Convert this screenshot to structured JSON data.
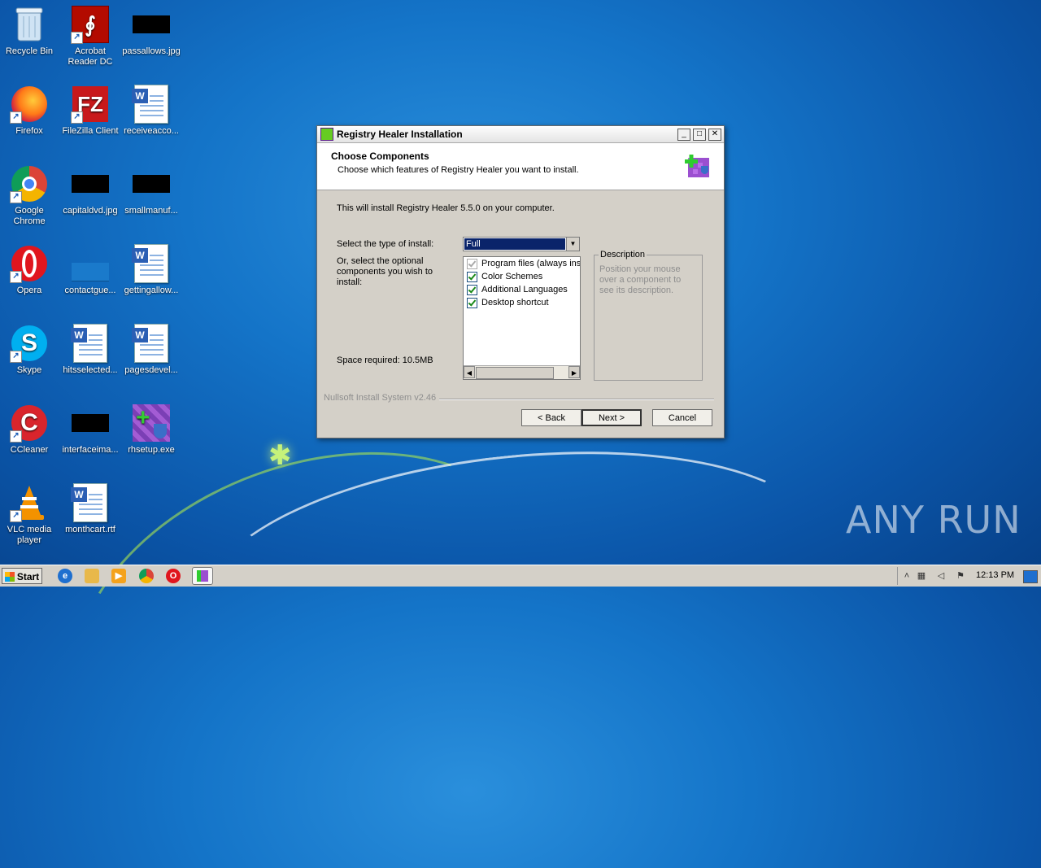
{
  "desktop": {
    "icons": [
      {
        "label": "Recycle Bin"
      },
      {
        "label": "Acrobat Reader DC"
      },
      {
        "label": "passallows.jpg"
      },
      {
        "label": "Firefox"
      },
      {
        "label": "FileZilla Client"
      },
      {
        "label": "receiveacco..."
      },
      {
        "label": "Google Chrome"
      },
      {
        "label": "capitaldvd.jpg"
      },
      {
        "label": "smallmanuf..."
      },
      {
        "label": "Opera"
      },
      {
        "label": "contactgue..."
      },
      {
        "label": "gettingallow..."
      },
      {
        "label": "Skype"
      },
      {
        "label": "hitsselected..."
      },
      {
        "label": "pagesdevel..."
      },
      {
        "label": "CCleaner"
      },
      {
        "label": "interfaceima..."
      },
      {
        "label": "rhsetup.exe"
      },
      {
        "label": "VLC media player"
      },
      {
        "label": "monthcart.rtf"
      }
    ]
  },
  "dialog": {
    "title": "Registry Healer Installation",
    "header_title": "Choose Components",
    "header_subtitle": "Choose which features of Registry Healer you want to install.",
    "intro": "This will install Registry Healer 5.5.0 on your computer.",
    "select_type_label": "Select the type of install:",
    "install_type": "Full",
    "optional_label": "Or, select the optional components you wish to install:",
    "space_required": "Space required: 10.5MB",
    "components": [
      {
        "label": "Program files (always installed)",
        "checked": true,
        "disabled": true
      },
      {
        "label": "Color Schemes",
        "checked": true,
        "disabled": false
      },
      {
        "label": "Additional Languages",
        "checked": true,
        "disabled": false
      },
      {
        "label": "Desktop shortcut",
        "checked": true,
        "disabled": false
      }
    ],
    "description_legend": "Description",
    "description_text": "Position your mouse over a component to see its description.",
    "branding": "Nullsoft Install System v2.46",
    "back_label": "< Back",
    "next_label": "Next >",
    "cancel_label": "Cancel"
  },
  "taskbar": {
    "start_label": "Start",
    "clock": "12:13 PM"
  },
  "watermark": "ANY RUN"
}
